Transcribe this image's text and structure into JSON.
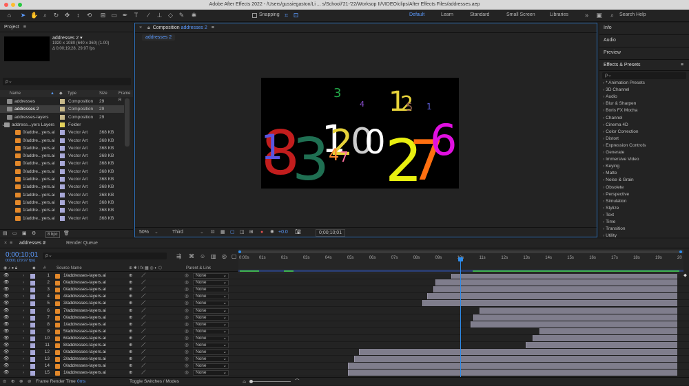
{
  "window": {
    "title": "Adobe After Effects 2022 - /Users/gussiegaston/Li ... s/School/'21-'22/Worksop II/VIDEO/clips/After Effects Files/addresses.aep"
  },
  "toolbar": {
    "snapping": "Snapping",
    "workspaces": [
      "Default",
      "Learn",
      "Standard",
      "Small Screen",
      "Libraries"
    ],
    "search_help": "Search Help"
  },
  "project": {
    "title": "Project",
    "selected_name": "addresses 2 ▾",
    "selected_info1": "1920 x 1080  (640 x 360) (1.00)",
    "selected_info2": "Δ 0;00;19;28, 29.97 fps",
    "search_placeholder": "ρ⌄",
    "col_name": "Name",
    "col_type": "Type",
    "col_size": "Size",
    "col_frame": "Frame R",
    "bpc": "8 bpc",
    "items": [
      {
        "name": "addresses",
        "type": "Composition",
        "size": "29",
        "kind": "comp",
        "color": "#c8b98a"
      },
      {
        "name": "addresses 2",
        "type": "Composition",
        "size": "29",
        "kind": "comp",
        "color": "#c8b98a",
        "selected": true
      },
      {
        "name": "addresses-layers",
        "type": "Composition",
        "size": "29",
        "kind": "comp",
        "color": "#c8b98a"
      },
      {
        "name": "address...yers Layers",
        "type": "Folder",
        "size": "",
        "kind": "folder",
        "color": "#e3d25c"
      },
      {
        "name": "0/addre...yers.ai",
        "type": "Vector Art",
        "size": "368 KB",
        "kind": "ai",
        "color": "#a8a8d8"
      },
      {
        "name": "0/addre...yers.ai",
        "type": "Vector Art",
        "size": "368 KB",
        "kind": "ai",
        "color": "#a8a8d8"
      },
      {
        "name": "0/addre...yers.ai",
        "type": "Vector Art",
        "size": "368 KB",
        "kind": "ai",
        "color": "#a8a8d8"
      },
      {
        "name": "0/addre...yers.ai",
        "type": "Vector Art",
        "size": "368 KB",
        "kind": "ai",
        "color": "#a8a8d8"
      },
      {
        "name": "0/addre...yers.ai",
        "type": "Vector Art",
        "size": "368 KB",
        "kind": "ai",
        "color": "#a8a8d8"
      },
      {
        "name": "0/addre...yers.ai",
        "type": "Vector Art",
        "size": "368 KB",
        "kind": "ai",
        "color": "#a8a8d8"
      },
      {
        "name": "1/addre...yers.ai",
        "type": "Vector Art",
        "size": "368 KB",
        "kind": "ai",
        "color": "#a8a8d8"
      },
      {
        "name": "1/addre...yers.ai",
        "type": "Vector Art",
        "size": "368 KB",
        "kind": "ai",
        "color": "#a8a8d8"
      },
      {
        "name": "1/addre...yers.ai",
        "type": "Vector Art",
        "size": "368 KB",
        "kind": "ai",
        "color": "#a8a8d8"
      },
      {
        "name": "1/addre...yers.ai",
        "type": "Vector Art",
        "size": "368 KB",
        "kind": "ai",
        "color": "#a8a8d8"
      },
      {
        "name": "1/addre...yers.ai",
        "type": "Vector Art",
        "size": "368 KB",
        "kind": "ai",
        "color": "#a8a8d8"
      },
      {
        "name": "1/addre...yers.ai",
        "type": "Vector Art",
        "size": "368 KB",
        "kind": "ai",
        "color": "#a8a8d8"
      }
    ]
  },
  "composition": {
    "tab_label": "Composition",
    "tab_name": "addresses 2",
    "breadcrumb": "addresses 2",
    "zoom": "50%",
    "resolution": "Third",
    "exposure": "+0.0",
    "timecode": "0;00;10;01"
  },
  "right": {
    "info": "Info",
    "audio": "Audio",
    "preview": "Preview",
    "effects_title": "Effects & Presets",
    "search_placeholder": "ρ⌄",
    "effects": [
      "* Animation Presets",
      "3D Channel",
      "Audio",
      "Blur & Sharpen",
      "Boris FX Mocha",
      "Channel",
      "Cinema 4D",
      "Color Correction",
      "Distort",
      "Expression Controls",
      "Generate",
      "Immersive Video",
      "Keying",
      "Matte",
      "Noise & Grain",
      "Obsolete",
      "Perspective",
      "Simulation",
      "Stylize",
      "Text",
      "Time",
      "Transition",
      "Utility"
    ]
  },
  "timeline": {
    "tab": "addresses 2",
    "render_queue": "Render Queue",
    "timecode": "0;00;10;01",
    "subcode": "00301 (29.97 fps)",
    "search_placeholder": "ρ⌄",
    "hdr_hash": "#",
    "hdr_source": "Source Name",
    "hdr_parent": "Parent & Link",
    "frame_render_label": "Frame Render Time",
    "frame_render_value": "0ms",
    "toggle_label": "Toggle Switches / Modes",
    "ticks": [
      "0:00s",
      "01s",
      "02s",
      "03s",
      "04s",
      "05s",
      "06s",
      "07s",
      "08s",
      "09s",
      "10s",
      "11s",
      "12s",
      "13s",
      "14s",
      "15s",
      "16s",
      "17s",
      "18s",
      "19s",
      "20"
    ],
    "current_time_s": 10.03,
    "duration_s": 20,
    "layers": [
      {
        "num": "1",
        "name": "1/addresses-layers.ai",
        "parent": "None",
        "start_s": 9.6
      },
      {
        "num": "2",
        "name": "0/addresses-layers.ai",
        "parent": "None",
        "start_s": 8.9
      },
      {
        "num": "3",
        "name": "0/addresses-layers.ai",
        "parent": "None",
        "start_s": 8.8
      },
      {
        "num": "4",
        "name": "4/addresses-layers.ai",
        "parent": "None",
        "start_s": 8.5
      },
      {
        "num": "5",
        "name": "3/addresses-layers.ai",
        "parent": "None",
        "start_s": 8.3
      },
      {
        "num": "6",
        "name": "7/addresses-layers.ai",
        "parent": "None",
        "start_s": 10.9
      },
      {
        "num": "7",
        "name": "0/addresses-layers.ai",
        "parent": "None",
        "start_s": 10.6
      },
      {
        "num": "8",
        "name": "1/addresses-layers.ai",
        "parent": "None",
        "start_s": 10.5
      },
      {
        "num": "9",
        "name": "5/addresses-layers.ai",
        "parent": "None",
        "start_s": 13.6
      },
      {
        "num": "10",
        "name": "6/addresses-layers.ai",
        "parent": "None",
        "start_s": 13.3
      },
      {
        "num": "11",
        "name": "8/addresses-layers.ai",
        "parent": "None",
        "start_s": 13.0
      },
      {
        "num": "12",
        "name": "0/addresses-layers.ai",
        "parent": "None",
        "start_s": 5.4
      },
      {
        "num": "13",
        "name": "2/addresses-layers.ai",
        "parent": "None",
        "start_s": 5.2
      },
      {
        "num": "14",
        "name": "0/addresses-layers.ai",
        "parent": "None",
        "start_s": 4.9
      },
      {
        "num": "15",
        "name": "1/addresses-layers.ai",
        "parent": "None",
        "start_s": 4.9
      }
    ]
  },
  "colors": {
    "accent": "#2d8ceb",
    "layer_label": "#a8a8d8",
    "bar": "#7f7d8c"
  }
}
